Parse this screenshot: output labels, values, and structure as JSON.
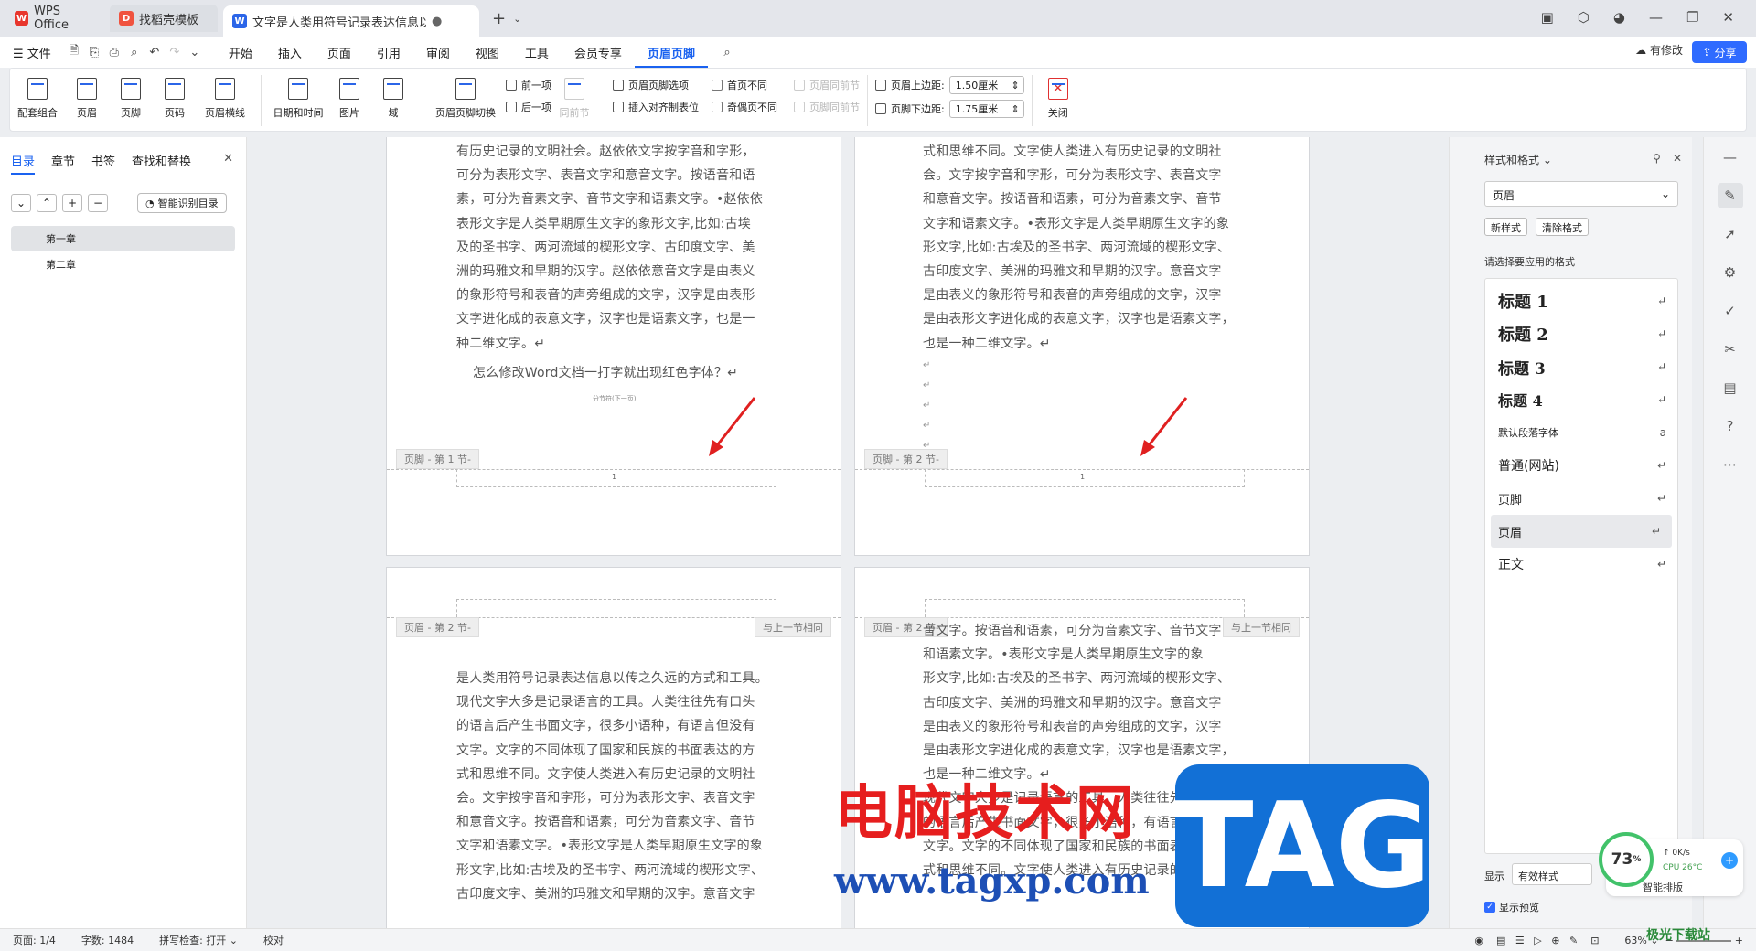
{
  "tabs": [
    {
      "label": "WPS Office",
      "icon": "wps-logo"
    },
    {
      "label": "找稻壳模板",
      "icon": "daoke-logo"
    },
    {
      "label": "文字是人类用符号记录表达信息以…",
      "icon": "writer-logo"
    }
  ],
  "menu": {
    "file": "文件",
    "items": [
      "开始",
      "插入",
      "页面",
      "引用",
      "审阅",
      "视图",
      "工具",
      "会员专享",
      "页眉页脚"
    ],
    "modified": "有修改",
    "share": "分享"
  },
  "ribbon": {
    "big1": [
      "配套组合",
      "页眉",
      "页脚",
      "页码",
      "页眉横线"
    ],
    "big2": [
      "日期和时间",
      "图片",
      "域"
    ],
    "switch": "页眉页脚切换",
    "prev": "前一项",
    "next": "后一项",
    "same_prev": "同前节",
    "opts": "页眉页脚选项",
    "align_tab": "插入对齐制表位",
    "first_diff": "首页不同",
    "odd_even": "奇偶页不同",
    "hdr_same": "页眉同前节",
    "ftr_same": "页脚同前节",
    "top_label": "页眉上边距:",
    "top_val": "1.50厘米",
    "bottom_label": "页脚下边距:",
    "bottom_val": "1.75厘米",
    "close": "关闭"
  },
  "left": {
    "tabs": [
      "目录",
      "章节",
      "书签",
      "查找和替换"
    ],
    "smart": "智能识别目录",
    "items": [
      "第一章",
      "第二章"
    ]
  },
  "doc": {
    "p1_lines": [
      "有历史记录的文明社会。赵依依文字按字音和字形，",
      "可分为表形文字、表音文字和意音文字。按语音和语",
      "素，可分为音素文字、音节文字和语素文字。•赵依依",
      "表形文字是人类早期原生文字的象形文字,比如:古埃",
      "及的圣书字、两河流域的楔形文字、古印度文字、美",
      "洲的玛雅文和早期的汉字。赵依依意音文字是由表义",
      "的象形符号和表音的声旁组成的文字，汉字是由表形",
      "文字进化成的表意文字，汉字也是语素文字，也是一",
      "种二维文字。↵"
    ],
    "p1_question": "怎么修改Word文档一打字就出现红色字体？↵",
    "p1_section": "分节符(下一页)",
    "p2_lines": [
      "式和思维不同。文字使人类进入有历史记录的文明社",
      "会。文字按字音和字形，可分为表形文字、表音文字",
      "和意音文字。按语音和语素，可分为音素文字、音节",
      "文字和语素文字。•表形文字是人类早期原生文字的象",
      "形文字,比如:古埃及的圣书字、两河流域的楔形文字、",
      "古印度文字、美洲的玛雅文和早期的汉字。意音文字",
      "是由表义的象形符号和表音的声旁组成的文字，汉字",
      "是由表形文字进化成的表意文字，汉字也是语素文字，",
      "也是一种二维文字。↵"
    ],
    "footer1": "页脚 - 第 1 节-",
    "footer2": "页脚 - 第 2 节-",
    "page_num": "1",
    "header3": "页眉 - 第 2 节-",
    "header4": "页眉 - 第 2 节-",
    "same_as_prev": "与上一节相同",
    "p3_lines": [
      "是人类用符号记录表达信息以传之久远的方式和工具。",
      "现代文字大多是记录语言的工具。人类往往先有口头",
      "的语言后产生书面文字，很多小语种，有语言但没有",
      "文字。文字的不同体现了国家和民族的书面表达的方",
      "式和思维不同。文字使人类进入有历史记录的文明社",
      "会。文字按字音和字形，可分为表形文字、表音文字",
      "和意音文字。按语音和语素，可分为音素文字、音节",
      "文字和语素文字。•表形文字是人类早期原生文字的象",
      "形文字,比如:古埃及的圣书字、两河流域的楔形文字、",
      "古印度文字、美洲的玛雅文和早期的汉字。意音文字"
    ],
    "p4_lines": [
      "音文字。按语音和语素，可分为音素文字、音节文字",
      "和语素文字。•表形文字是人类早期原生文字的象",
      "形文字,比如:古埃及的圣书字、两河流域的楔形文字、",
      "古印度文字、美洲的玛雅文和早期的汉字。意音文字",
      "是由表义的象形符号和表音的声旁组成的文字，汉字",
      "是由表形文字进化成的表意文字，汉字也是语素文字，",
      "也是一种二维文字。↵",
      "现代文字大多是记录语言的工具。人类往往先有口头",
      "的语言后产生书面文字，很多小语种，有语言但没有",
      "文字。文字的不同体现了国家和民族的书面表达的方",
      "式和思维不同。文字使人类进入有历史记录的文明社"
    ]
  },
  "styles": {
    "title": "样式和格式",
    "current": "页眉",
    "new_style": "新样式",
    "clear": "清除格式",
    "prompt": "请选择要应用的格式",
    "items": [
      "标题 1",
      "标题 2",
      "标题 3",
      "标题 4",
      "默认段落字体",
      "普通(网站)",
      "页脚",
      "页眉",
      "正文"
    ],
    "show_label": "显示",
    "show_value": "有效样式",
    "preview": "显示预览",
    "smart": "智能排版"
  },
  "perf": {
    "pct": "73",
    "unit": "%",
    "net": "0K/s",
    "cpu": "CPU 26°C"
  },
  "status": {
    "page": "页面: 1/4",
    "words": "字数: 1484",
    "spell": "拼写检查: 打开",
    "proof": "校对",
    "zoom": "63%"
  },
  "watermark": {
    "cn": "电脑技术网",
    "url": "www.tagxp.com",
    "tag": "TAG",
    "corner": "极光下载站"
  },
  "colors": {
    "accent": "#1a62f0",
    "arrow": "#e02020"
  }
}
